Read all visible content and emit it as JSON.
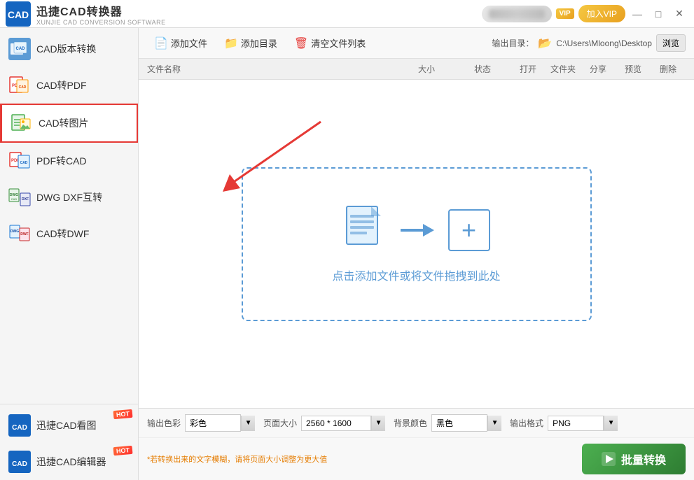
{
  "titleBar": {
    "appName": "迅捷CAD转换器",
    "appSub": "XUNJIE CAD CONVERSION SOFTWARE",
    "vipLabel": "VIP",
    "joinVipLabel": "加入VIP",
    "minBtn": "—",
    "maxBtn": "□",
    "closeBtn": "✕"
  },
  "sidebar": {
    "items": [
      {
        "id": "cad-version",
        "label": "CAD版本转换",
        "active": false
      },
      {
        "id": "cad-pdf",
        "label": "CAD转PDF",
        "active": false
      },
      {
        "id": "cad-img",
        "label": "CAD转图片",
        "active": true
      },
      {
        "id": "pdf-cad",
        "label": "PDF转CAD",
        "active": false
      },
      {
        "id": "dwg-dxf",
        "label": "DWG DXF互转",
        "active": false
      },
      {
        "id": "cad-dwf",
        "label": "CAD转DWF",
        "active": false
      }
    ],
    "bottomItems": [
      {
        "id": "cad-viewer",
        "label": "迅捷CAD看图",
        "hot": true
      },
      {
        "id": "cad-editor",
        "label": "迅捷CAD编辑器",
        "hot": true
      }
    ]
  },
  "toolbar": {
    "addFileLabel": "添加文件",
    "addFolderLabel": "添加目录",
    "clearListLabel": "清空文件列表",
    "outputDirLabel": "输出目录：",
    "outputPath": "C:\\Users\\Mloong\\Desktop",
    "browseLabel": "浏览"
  },
  "fileListHeader": {
    "name": "文件名称",
    "size": "大小",
    "status": "状态",
    "open": "打开",
    "folder": "文件夹",
    "share": "分享",
    "preview": "预览",
    "delete": "删除"
  },
  "dropZone": {
    "text": "点击添加文件或将文件拖拽到此处"
  },
  "bottomBar": {
    "colorLabel": "输出色彩",
    "colorValue": "彩色",
    "pageSizeLabel": "页面大小",
    "pageSizeValue": "2560 * 1600",
    "bgColorLabel": "背景颜色",
    "bgColorValue": "黑色",
    "outputFormatLabel": "输出格式",
    "outputFormatValue": "PNG",
    "hintText": "*若转换出来的文字模糊，请将页面大小调整为更大值",
    "convertLabel": "批量转换"
  }
}
